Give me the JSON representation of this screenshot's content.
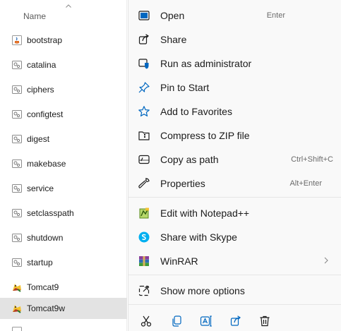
{
  "file_list": {
    "column_header": "Name",
    "items": [
      {
        "name": "bootstrap",
        "icon": "java-jar-icon"
      },
      {
        "name": "catalina",
        "icon": "batch-file-icon"
      },
      {
        "name": "ciphers",
        "icon": "batch-file-icon"
      },
      {
        "name": "configtest",
        "icon": "batch-file-icon"
      },
      {
        "name": "digest",
        "icon": "batch-file-icon"
      },
      {
        "name": "makebase",
        "icon": "batch-file-icon"
      },
      {
        "name": "service",
        "icon": "batch-file-icon"
      },
      {
        "name": "setclasspath",
        "icon": "batch-file-icon"
      },
      {
        "name": "shutdown",
        "icon": "batch-file-icon"
      },
      {
        "name": "startup",
        "icon": "batch-file-icon"
      },
      {
        "name": "Tomcat9",
        "icon": "tomcat-icon"
      },
      {
        "name": "Tomcat9w",
        "icon": "tomcat-icon",
        "selected": true
      }
    ]
  },
  "context_menu": {
    "items": [
      {
        "label": "Open",
        "shortcut": "Enter",
        "icon": "open-icon"
      },
      {
        "label": "Share",
        "shortcut": "",
        "icon": "share-icon"
      },
      {
        "label": "Run as administrator",
        "shortcut": "",
        "icon": "shield-icon"
      },
      {
        "label": "Pin to Start",
        "shortcut": "",
        "icon": "pin-icon"
      },
      {
        "label": "Add to Favorites",
        "shortcut": "",
        "icon": "star-icon"
      },
      {
        "label": "Compress to ZIP file",
        "shortcut": "",
        "icon": "zip-icon"
      },
      {
        "label": "Copy as path",
        "shortcut": "Ctrl+Shift+C",
        "icon": "copy-path-icon"
      },
      {
        "label": "Properties",
        "shortcut": "Alt+Enter",
        "icon": "wrench-icon"
      },
      {
        "label": "Edit with Notepad++",
        "shortcut": "",
        "icon": "notepad-plus-plus-icon"
      },
      {
        "label": "Share with Skype",
        "shortcut": "",
        "icon": "skype-icon"
      },
      {
        "label": "WinRAR",
        "shortcut": "",
        "icon": "winrar-icon",
        "submenu": true
      },
      {
        "label": "Show more options",
        "shortcut": "",
        "icon": "show-more-icon"
      }
    ],
    "quick_actions": [
      "cut-icon",
      "copy-icon",
      "rename-icon",
      "share-icon",
      "delete-icon"
    ]
  },
  "colors": {
    "menu_bg": "#f9f9f9",
    "selected_row": "#e3e3e3",
    "accent_blue": "#0067c0",
    "skype_blue": "#00aff0"
  }
}
